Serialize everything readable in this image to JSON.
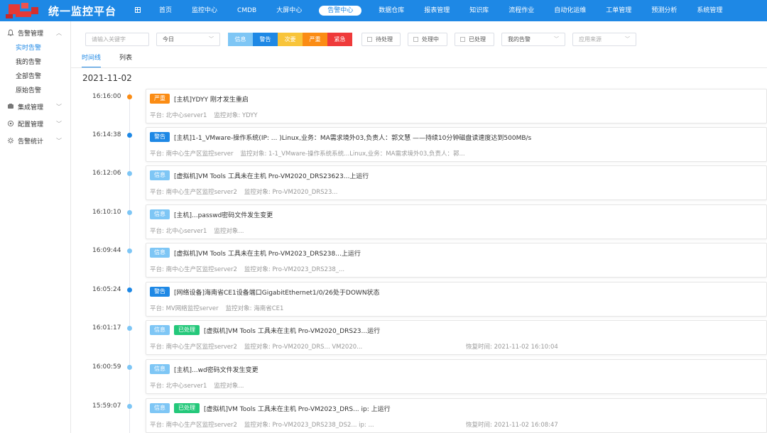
{
  "app": {
    "title": "统一监控平台"
  },
  "colors": {
    "primary": "#1e88e5",
    "info": "#7ec6f5",
    "warning": "#1e88e5",
    "minor": "#f8c43a",
    "severe": "#fb8c14",
    "critical": "#ef3a3a",
    "processed": "#24c87a"
  },
  "nav": [
    {
      "label": "",
      "icon": "grid-icon"
    },
    {
      "label": "首页"
    },
    {
      "label": "监控中心"
    },
    {
      "label": "CMDB"
    },
    {
      "label": "大屏中心"
    },
    {
      "label": "告警中心",
      "active": true
    },
    {
      "label": "数据仓库"
    },
    {
      "label": "报表管理"
    },
    {
      "label": "知识库"
    },
    {
      "label": "流程作业"
    },
    {
      "label": "自动化运维"
    },
    {
      "label": "工单管理"
    },
    {
      "label": "预测分析"
    },
    {
      "label": "系统管理"
    }
  ],
  "sidebar": {
    "group1": {
      "label": "告警管理",
      "icon": "bell-icon"
    },
    "subs": [
      {
        "label": "实时告警",
        "active": true
      },
      {
        "label": "我的告警"
      },
      {
        "label": "全部告警"
      },
      {
        "label": "原始告警"
      }
    ],
    "group2": {
      "label": "集成管理",
      "icon": "integration-icon"
    },
    "group3": {
      "label": "配置管理",
      "icon": "config-icon"
    },
    "group4": {
      "label": "告警统计",
      "icon": "gear-icon"
    }
  },
  "filters": {
    "keyword_placeholder": "请输入关键字",
    "period": "今日",
    "levels": [
      "信息",
      "警告",
      "次要",
      "严重",
      "紧急"
    ],
    "status": [
      "待处理",
      "处理中",
      "已处理"
    ],
    "mine": "我的告警",
    "source_placeholder": "应用来源"
  },
  "tabs": [
    "时间线",
    "列表"
  ],
  "date": "2021-11-02",
  "entries": [
    {
      "time": "16:16:00",
      "dot": "#fb8c14",
      "level": "严重",
      "level_color": "#fb8c14",
      "title": "[主机]YDYY 刚才发生重启",
      "platform": "平台: 北中心server1",
      "object": "监控对象: YDYY"
    },
    {
      "time": "16:14:38",
      "dot": "#1e88e5",
      "level": "警告",
      "level_color": "#1e88e5",
      "title": "[主机]1-1_VMware-操作系统(IP:   ...  )Linux,业务：MA需求境外03,负责人：郭文慧 ——持续10分钟磁盘读速度达到500MB/s",
      "platform": "平台: 南中心生产区监控server",
      "object": "监控对象: 1-1_VMware-操作系统系统...Linux,业务：MA需求境外03,负责人：郭..."
    },
    {
      "time": "16:12:06",
      "dot": "#7ec6f5",
      "level": "信息",
      "level_color": "#7ec6f5",
      "title": "[虚拟机]VM Tools 工具未在主机 Pro-VM2020_DRS23623...上运行",
      "platform": "平台: 南中心生产区监控server2",
      "object": "监控对象: Pro-VM2020_DRS23..."
    },
    {
      "time": "16:10:10",
      "dot": "#7ec6f5",
      "level": "信息",
      "level_color": "#7ec6f5",
      "title": "[主机]...passwd密码文件发生变更",
      "platform": "平台: 北中心server1",
      "object": "监控对象..."
    },
    {
      "time": "16:09:44",
      "dot": "#7ec6f5",
      "level": "信息",
      "level_color": "#7ec6f5",
      "title": "[虚拟机]VM Tools 工具未在主机 Pro-VM2023_DRS238...上运行",
      "platform": "平台: 南中心生产区监控server2",
      "object": "监控对象: Pro-VM2023_DRS238_..."
    },
    {
      "time": "16:05:24",
      "dot": "#1e88e5",
      "level": "警告",
      "level_color": "#1e88e5",
      "title": "[网络设备]海南省CE1设备端口GigabitEthernet1/0/26处于DOWN状态",
      "platform": "平台: MV网络监控server",
      "object": "监控对象: 海南省CE1"
    },
    {
      "time": "16:01:17",
      "dot": "#7ec6f5",
      "level": "信息",
      "level_color": "#7ec6f5",
      "status": "已处理",
      "title": "[虚拟机]VM Tools 工具未在主机 Pro-VM2020_DRS23...运行",
      "platform": "平台: 南中心生产区监控server2",
      "object": "监控对象: Pro-VM2020_DRS...  VM2020...",
      "restore": "恢复时间: 2021-11-02 16:10:04"
    },
    {
      "time": "16:00:59",
      "dot": "#7ec6f5",
      "level": "信息",
      "level_color": "#7ec6f5",
      "title": "[主机]...wd密码文件发生变更",
      "platform": "平台: 北中心server1",
      "object": "监控对象..."
    },
    {
      "time": "15:59:07",
      "dot": "#7ec6f5",
      "level": "信息",
      "level_color": "#7ec6f5",
      "status": "已处理",
      "title": "[虚拟机]VM Tools 工具未在主机 Pro-VM2023_DRS...  ip: 上运行",
      "platform": "平台: 南中心生产区监控server2",
      "object": "监控对象: Pro-VM2023_DRS238_DS2...  ip: ...",
      "restore": "恢复时间: 2021-11-02 16:08:47"
    }
  ]
}
